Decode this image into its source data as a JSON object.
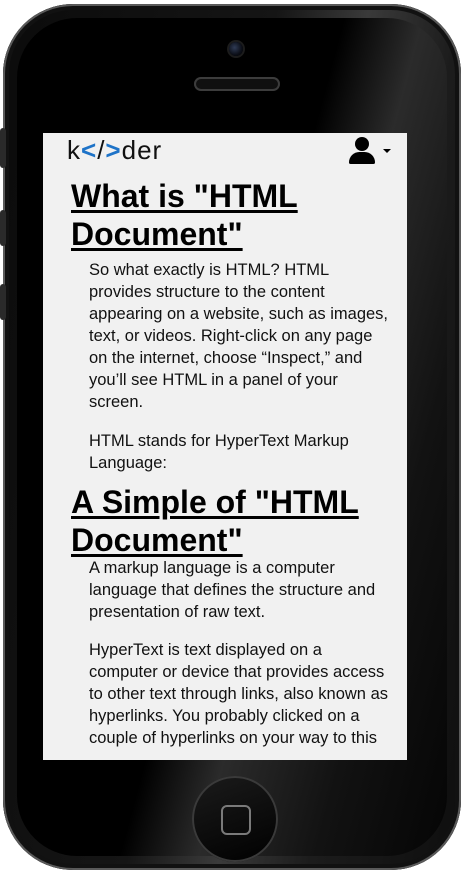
{
  "app": {
    "logo_prefix": "k",
    "logo_open": "<",
    "logo_slash": "/",
    "logo_close": ">",
    "logo_suffix": "der"
  },
  "article": {
    "heading_1": "What is \"HTML Document\"",
    "paragraph_1": "So what exactly is HTML? HTML provides structure to the content appearing on a website, such as images, text, or videos. Right-click on any page on the internet, choose “Inspect,” and you’ll see HTML in a panel of your screen.",
    "paragraph_2": "HTML stands for HyperText Markup Language:",
    "heading_2": "A Simple of \"HTML Document\"",
    "paragraph_3": "A markup language is a computer language that defines the structure and presentation of raw text.",
    "paragraph_4": "HyperText is text displayed on a computer or device that provides access to other text through links, also known as hyperlinks. You probably clicked on a couple of hyperlinks on your way to this"
  },
  "icons": {
    "user": "user-icon",
    "caret": "chevron-down-icon",
    "home": "home-button"
  },
  "colors": {
    "logo_brackets": "#1e73c8",
    "screen_bg": "#f1f1f1",
    "phone_body": "#0b0b0b"
  }
}
